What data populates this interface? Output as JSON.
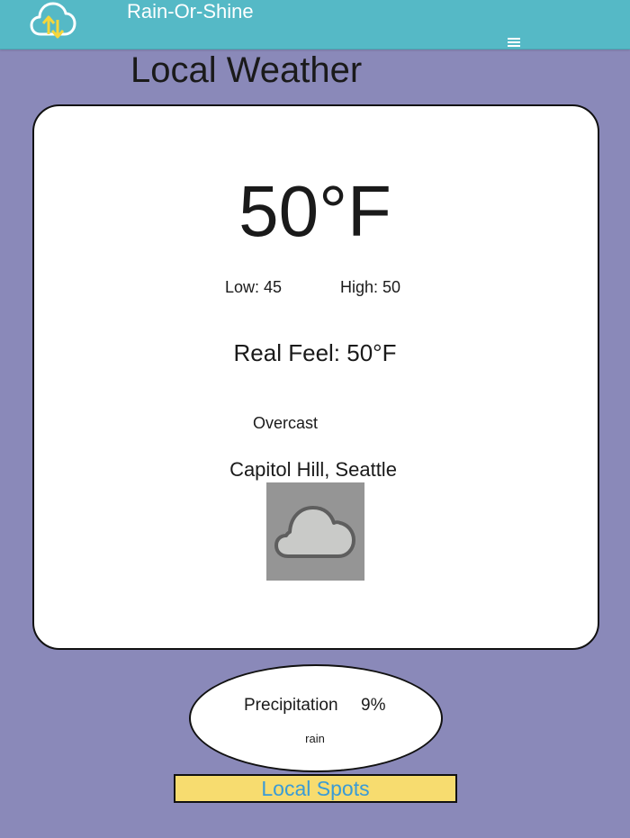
{
  "header": {
    "brand": "Rain-Or-Shine",
    "logo_icon": "cloud-sync-icon",
    "menu_icon": "hamburger-menu-icon"
  },
  "page": {
    "title": "Local Weather"
  },
  "weather": {
    "temperature": "50°F",
    "low": "Low: 45",
    "high": "High: 50",
    "real_feel": "Real Feel: 50°F",
    "condition": "Overcast",
    "location": "Capitol Hill, Seattle",
    "condition_icon": "cloud-icon"
  },
  "precipitation": {
    "label": "Precipitation",
    "value": "9%",
    "type": "rain"
  },
  "actions": {
    "local_spots": "Local Spots"
  },
  "colors": {
    "background": "#8a89b9",
    "header": "#55b9c6",
    "button_bg": "#f7dc6f",
    "button_text": "#3a9bd6",
    "logo_arrows": "#f5d63b"
  }
}
